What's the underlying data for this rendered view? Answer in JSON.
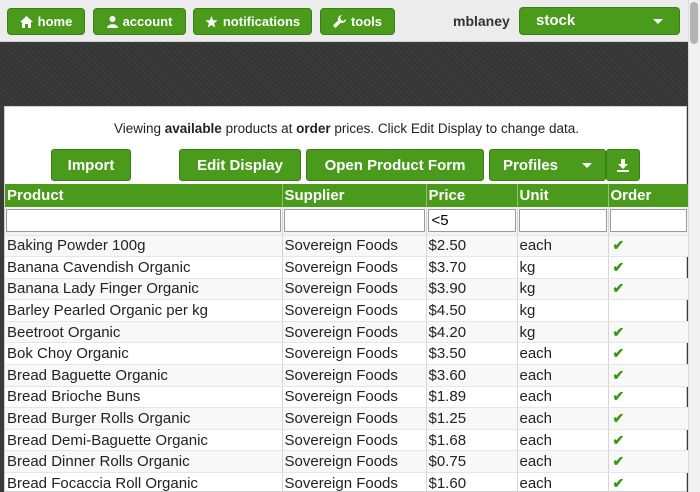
{
  "nav": {
    "home": "home",
    "account": "account",
    "notifications": "notifications",
    "tools": "tools"
  },
  "user": {
    "name": "mblaney"
  },
  "stock_select": {
    "selected": "stock"
  },
  "info": {
    "prefix": "Viewing ",
    "available": "available",
    "mid": " products at ",
    "order": "order",
    "suffix": " prices. Click Edit Display to change data."
  },
  "buttons": {
    "import": "Import",
    "edit_display": "Edit Display",
    "open_product_form": "Open Product Form",
    "profiles": "Profiles"
  },
  "table": {
    "headers": [
      "Product",
      "Supplier",
      "Price",
      "Unit",
      "Order"
    ],
    "filters": [
      "",
      "",
      "<5",
      "",
      ""
    ],
    "rows": [
      {
        "product": "Baking Powder 100g",
        "supplier": "Sovereign Foods",
        "price": "$2.50",
        "unit": "each",
        "order": "✔"
      },
      {
        "product": "Banana Cavendish Organic",
        "supplier": "Sovereign Foods",
        "price": "$3.70",
        "unit": "kg",
        "order": "✔"
      },
      {
        "product": "Banana Lady Finger Organic",
        "supplier": "Sovereign Foods",
        "price": "$3.90",
        "unit": "kg",
        "order": "✔"
      },
      {
        "product": "Barley Pearled Organic per kg",
        "supplier": "Sovereign Foods",
        "price": "$4.50",
        "unit": "kg",
        "order": ""
      },
      {
        "product": "Beetroot Organic",
        "supplier": "Sovereign Foods",
        "price": "$4.20",
        "unit": "kg",
        "order": "✔"
      },
      {
        "product": "Bok Choy Organic",
        "supplier": "Sovereign Foods",
        "price": "$3.50",
        "unit": "each",
        "order": "✔"
      },
      {
        "product": "Bread Baguette Organic",
        "supplier": "Sovereign Foods",
        "price": "$3.60",
        "unit": "each",
        "order": "✔"
      },
      {
        "product": "Bread Brioche Buns",
        "supplier": "Sovereign Foods",
        "price": "$1.89",
        "unit": "each",
        "order": "✔"
      },
      {
        "product": "Bread Burger Rolls Organic",
        "supplier": "Sovereign Foods",
        "price": "$1.25",
        "unit": "each",
        "order": "✔"
      },
      {
        "product": "Bread Demi-Baguette Organic",
        "supplier": "Sovereign Foods",
        "price": "$1.68",
        "unit": "each",
        "order": "✔"
      },
      {
        "product": "Bread Dinner Rolls Organic",
        "supplier": "Sovereign Foods",
        "price": "$0.75",
        "unit": "each",
        "order": "✔"
      },
      {
        "product": "Bread Focaccia Roll Organic",
        "supplier": "Sovereign Foods",
        "price": "$1.60",
        "unit": "each",
        "order": "✔"
      }
    ]
  },
  "colors": {
    "accent": "#4a9a1c",
    "check": "#3a9a14"
  }
}
